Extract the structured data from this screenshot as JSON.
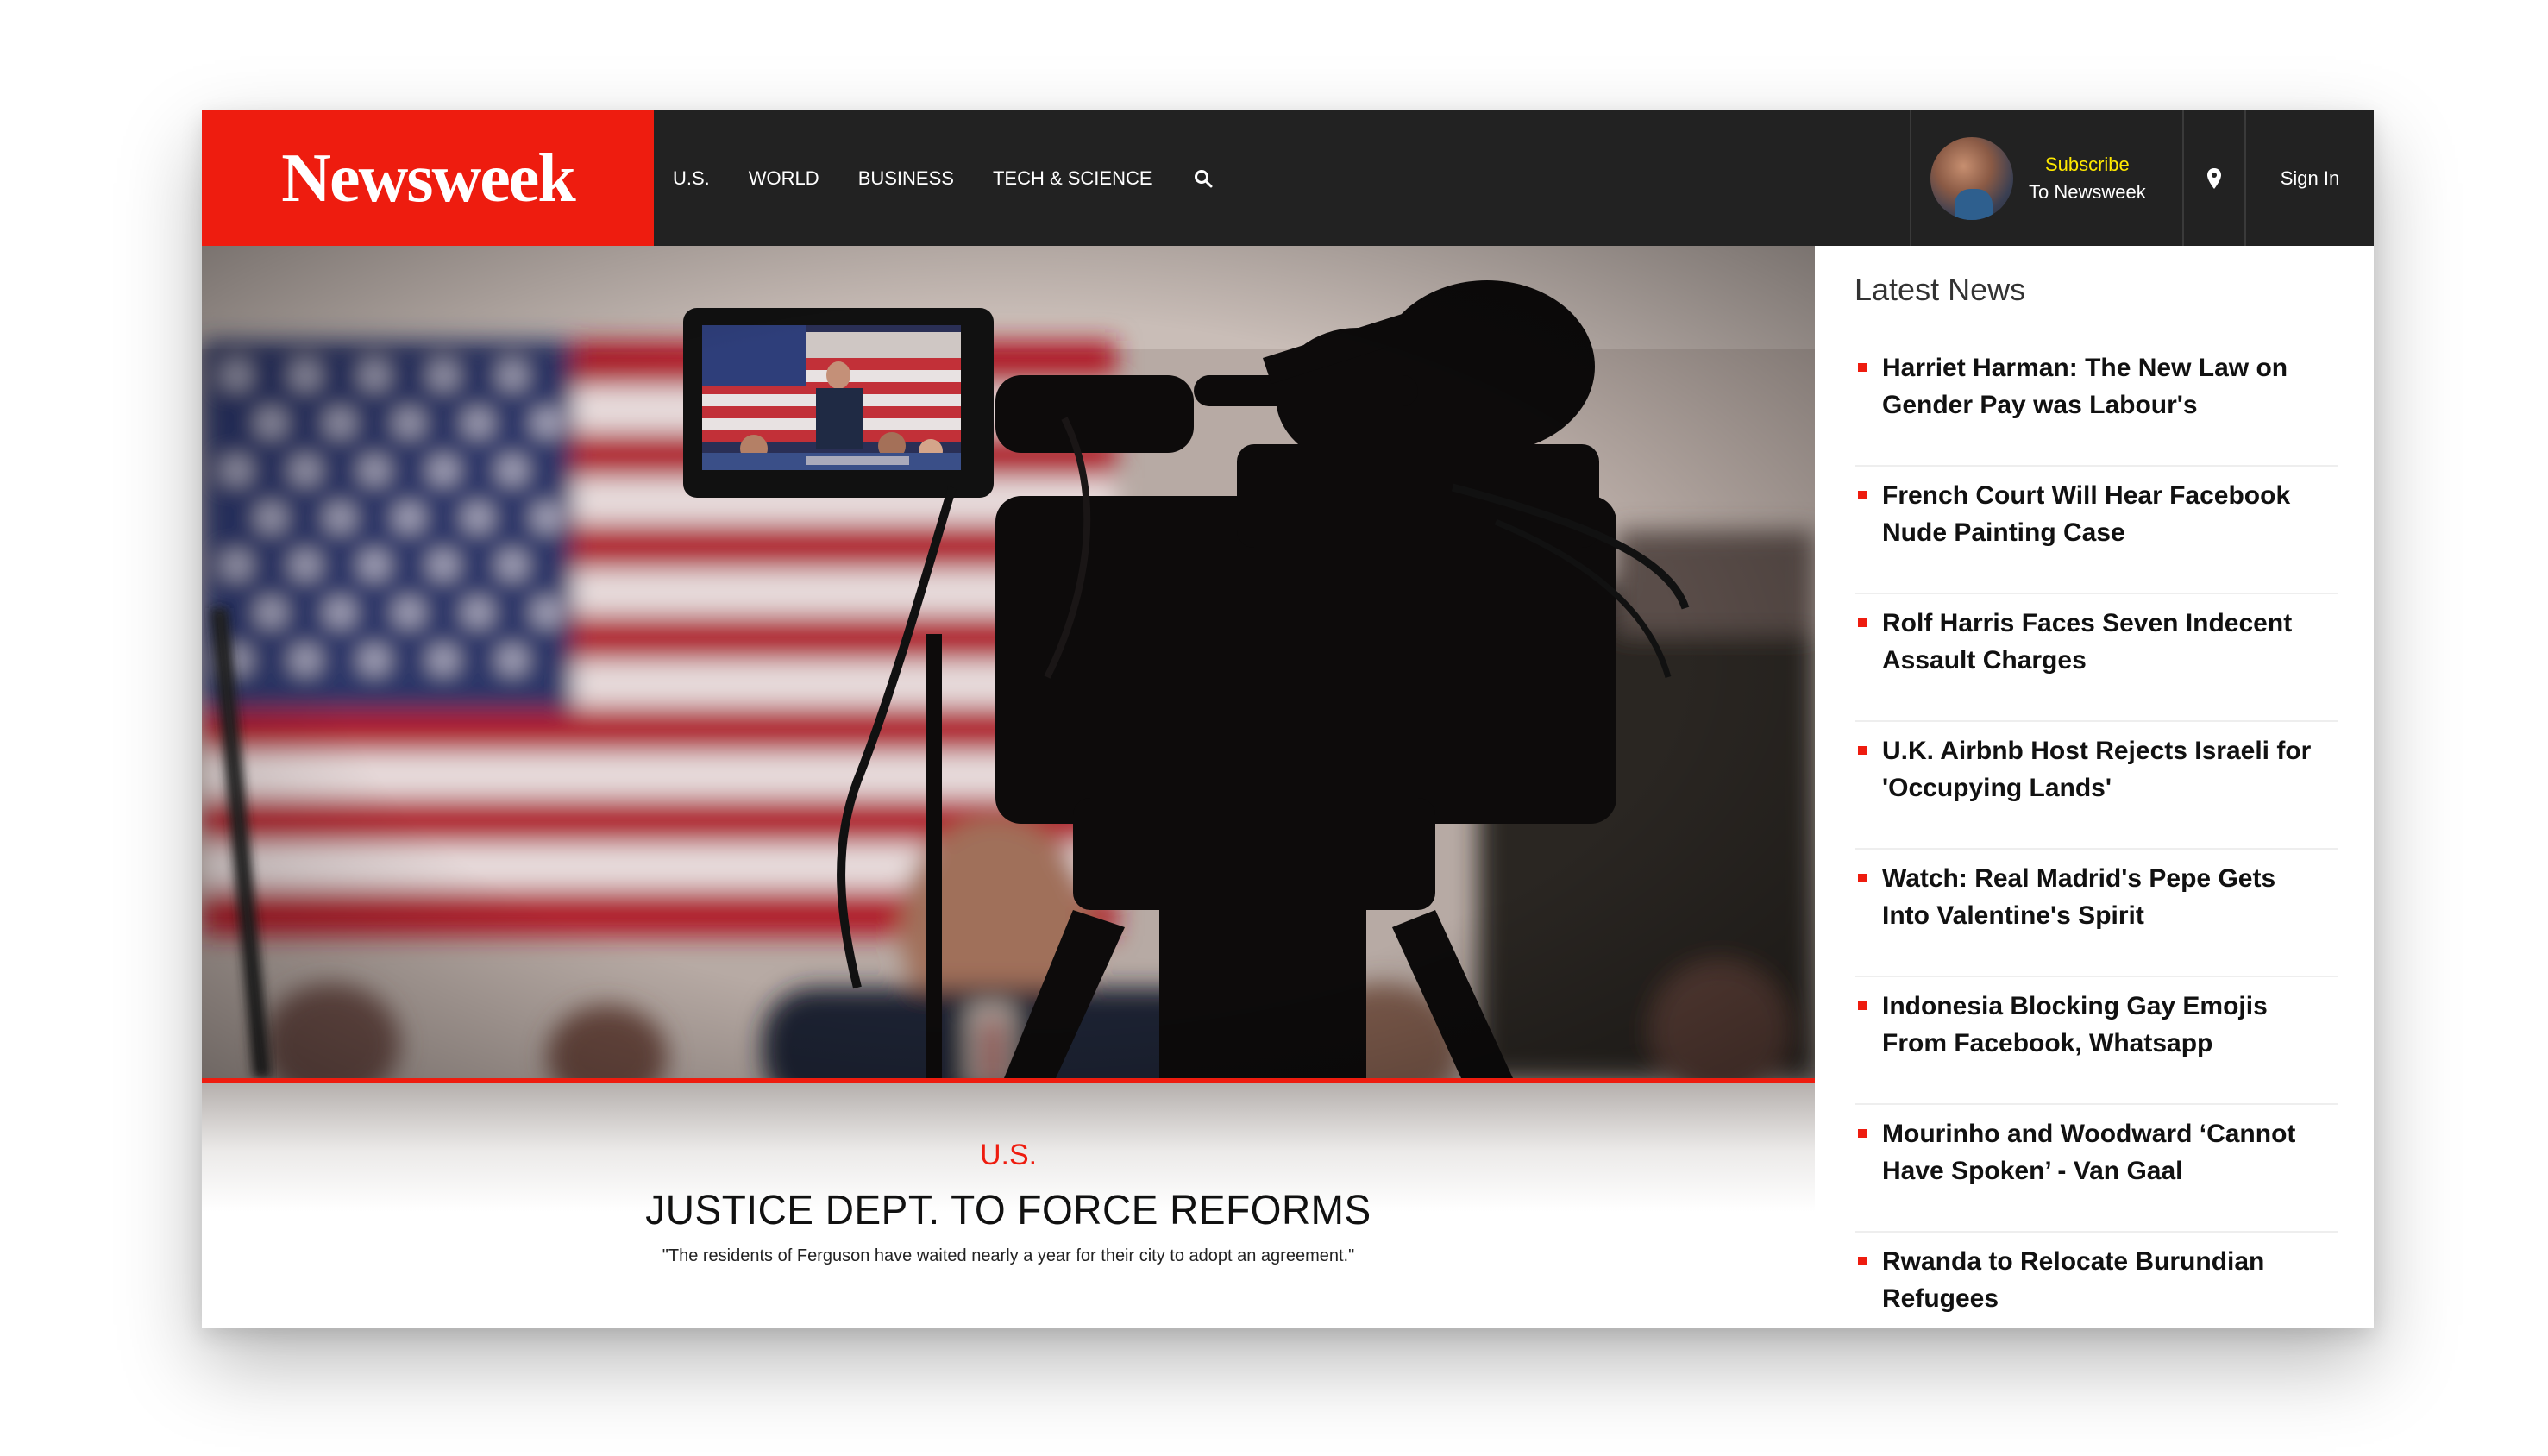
{
  "header": {
    "logo": "Newsweek",
    "nav": [
      "U.S.",
      "WORLD",
      "BUSINESS",
      "TECH & SCIENCE"
    ],
    "subscribe_line1": "Subscribe",
    "subscribe_line2": "To Newsweek",
    "signin": "Sign In",
    "icons": {
      "search": "search-icon",
      "location": "location-pin-icon"
    }
  },
  "hero": {
    "section": "U.S.",
    "title": "JUSTICE DEPT. TO FORCE REFORMS",
    "dek": "\"The residents of Ferguson have waited nearly a year for their city to adopt an agreement.\""
  },
  "latest": {
    "title": "Latest News",
    "items": [
      {
        "line1": "Harriet Harman: The New Law on",
        "line2": "Gender Pay was Labour's"
      },
      {
        "line1": "French Court Will Hear Facebook",
        "line2": "Nude Painting Case"
      },
      {
        "line1": "Rolf Harris Faces Seven Indecent",
        "line2": "Assault Charges"
      },
      {
        "line1": "U.K. Airbnb Host Rejects Israeli for",
        "line2": "'Occupying Lands'"
      },
      {
        "line1": "Watch: Real Madrid's Pepe Gets",
        "line2": "Into Valentine's Spirit"
      },
      {
        "line1": "Indonesia Blocking Gay Emojis",
        "line2": "From Facebook, Whatsapp"
      },
      {
        "line1": "Mourinho and Woodward ‘Cannot",
        "line2": "Have Spoken’ - Van Gaal"
      },
      {
        "line1": "Rwanda to Relocate Burundian",
        "line2": "Refugees"
      }
    ]
  },
  "colors": {
    "brand_red": "#ee1c0f",
    "header_bg": "#222222",
    "subscribe_yellow": "#ffe900"
  }
}
